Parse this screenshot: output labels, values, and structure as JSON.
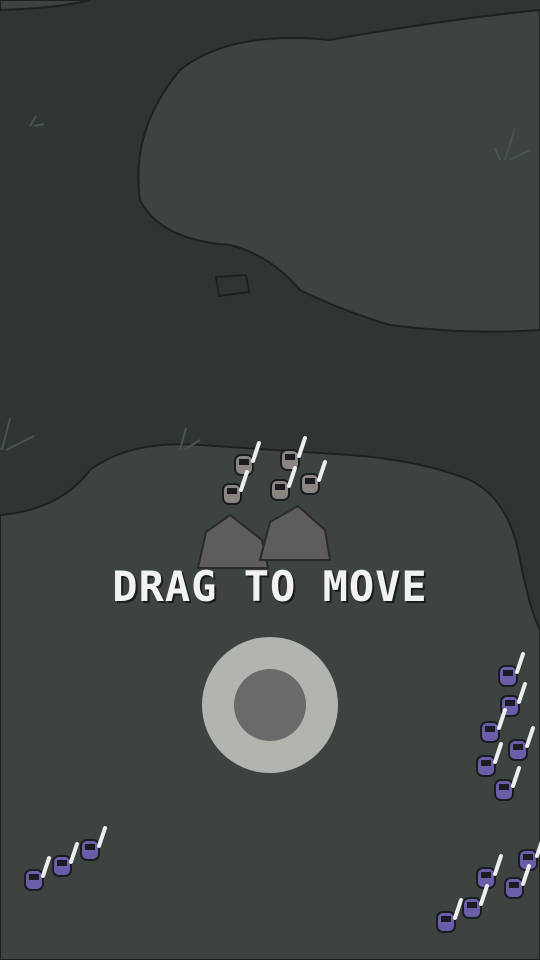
{
  "tutorial": {
    "text": "DRAG TO MOVE"
  },
  "colors": {
    "ground_dark": "#2f3531",
    "ground_light": "#3d433e",
    "player_units": "#8a8580",
    "enemy_units": "#6b5ea8",
    "rocks": "#5f5d5b",
    "joystick_base": "#b2b4b0",
    "joystick_knob": "#6a6a6a"
  },
  "icons": {
    "player_unit": "armored-knight-icon",
    "enemy_unit": "purple-ogre-icon",
    "obstacle": "rock-icon"
  }
}
